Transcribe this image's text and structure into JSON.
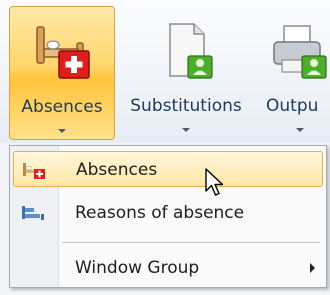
{
  "ribbon": {
    "buttons": [
      {
        "label": "Absences",
        "icon": "bed-absence-icon",
        "state": "pressed"
      },
      {
        "label": "Substitutions",
        "icon": "document-user-icon"
      },
      {
        "label": "Outpu",
        "icon": "printer-user-icon"
      }
    ]
  },
  "dropdown_menu": {
    "items": [
      {
        "label": "Absences",
        "icon": "bed-absence-small-icon",
        "state": "highlighted"
      },
      {
        "label": "Reasons of absence",
        "icon": "reasons-small-icon"
      },
      {
        "label": "Window Group",
        "has_submenu": true
      }
    ]
  },
  "colors": {
    "accent": "#ffd66b",
    "highlight_border": "#e0b449",
    "menu_background": "#fafafa",
    "ribbon_text": "#1e395b"
  }
}
